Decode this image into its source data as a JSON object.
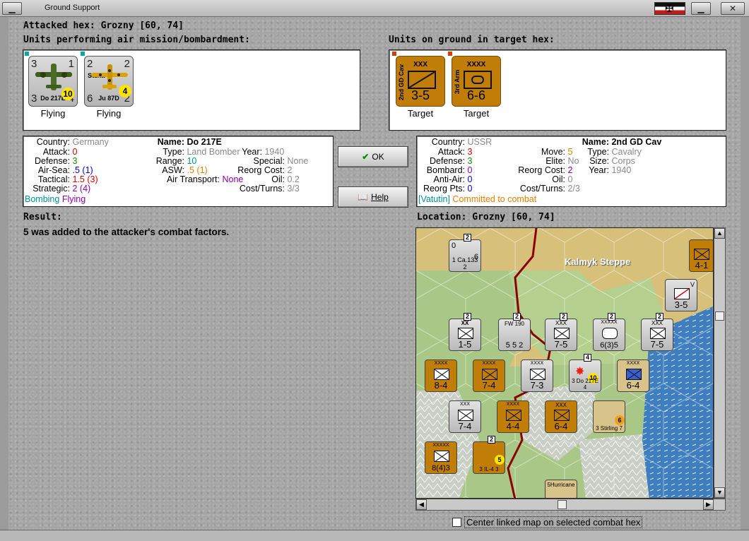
{
  "window": {
    "title": "Ground Support",
    "minimize_glyph": "▁",
    "close_glyph": "✕",
    "icon": "window-menu-icon",
    "flag": "german-war-flag-icon"
  },
  "attacked_hex": "Attacked hex: Grozny  [60, 74]",
  "air_section": {
    "heading": "Units performing air mission/bombardment:",
    "units": [
      {
        "name": "Do 217E",
        "top_left": "3",
        "top_right": "1",
        "bottom_left": "3",
        "bottom_right": "4",
        "badge": "10",
        "status": "Flying"
      },
      {
        "name": "Ju 87D",
        "sub": "Stuka",
        "top_left": "2",
        "top_right": "2",
        "bottom_left": "6",
        "bottom_right": "2",
        "badge": "4",
        "status": "Flying"
      }
    ]
  },
  "ground_section": {
    "heading": "Units on ground in target hex:",
    "units": [
      {
        "name": "2nd GD Cav",
        "echelon": "XXX",
        "values": "3-5",
        "status": "Target"
      },
      {
        "name": "3rd Arm",
        "echelon": "XXXX",
        "values": "6-6",
        "status": "Target"
      }
    ]
  },
  "attacker_info": {
    "country_label": "Country:",
    "country": "Germany",
    "attack_label": "Attack:",
    "attack": "0",
    "defense_label": "Defense:",
    "defense": "3",
    "airsea_label": "Air-Sea:",
    "airsea": ".5",
    "airsea_paren": "(1)",
    "tactical_label": "Tactical:",
    "tactical": "1.5",
    "tactical_paren": "(3)",
    "strategic_label": "Strategic:",
    "strategic": "2",
    "strategic_paren": "(4)",
    "mission": "Bombing",
    "mission_status": "Flying",
    "name_label": "Name:",
    "name": "Do 217E",
    "type_label": "Type:",
    "type": "Land Bomber",
    "year_label": "Year:",
    "year": "1940",
    "range_label": "Range:",
    "range": "10",
    "special_label": "Special:",
    "special": "None",
    "asw_label": "ASW:",
    "asw": ".5",
    "asw_paren": "(1)",
    "reorg_label": "Reorg Cost:",
    "reorg": "2",
    "airtransport_label": "Air Transport:",
    "airtransport": "None",
    "oil_label": "Oil:",
    "oil": "0.2",
    "cost_label": "Cost/Turns:",
    "cost": "3/3"
  },
  "buttons": {
    "ok": "OK",
    "help": "Help"
  },
  "defender_info": {
    "country_label": "Country:",
    "country": "USSR",
    "attack_label": "Attack:",
    "attack": "3",
    "defense_label": "Defense:",
    "defense": "3",
    "bombard_label": "Bombard:",
    "bombard": "0",
    "antiair_label": "Anti-Air:",
    "antiair": "0",
    "reorgpts_label": "Reorg Pts:",
    "reorgpts": "0",
    "commander": "[Vatutin]",
    "commit_status": "Committed to combat",
    "move_label": "Move:",
    "move": "5",
    "elite_label": "Elite:",
    "elite": "No",
    "reorg_label": "Reorg Cost:",
    "reorg": "2",
    "oil_label": "Oil:",
    "oil": "0",
    "cost_label": "Cost/Turns:",
    "cost": "2/3",
    "name_label": "Name:",
    "name": "2nd GD Cav",
    "type_label": "Type:",
    "type": "Cavalry",
    "size_label": "Size:",
    "size": "Corps",
    "year_label": "Year:",
    "year": "1940"
  },
  "result": {
    "heading": "Result:",
    "text": "5 was added to the attacker's combat factors."
  },
  "location": {
    "heading": "Location:  Grozny  [60, 74]",
    "region_label": "Kalmyk Steppe",
    "units": [
      {
        "id": "air-ca133",
        "kind": "g",
        "top": "0",
        "mid": "6",
        "bottom": "1 Ca.133 2",
        "stack": "2"
      },
      {
        "id": "corner-41",
        "kind": "b",
        "val": "4-1"
      },
      {
        "id": "vlasov",
        "kind": "g",
        "val": "3-5",
        "echelon": "V"
      },
      {
        "id": "u-15",
        "kind": "g",
        "val": "1-5",
        "echelon": "XX",
        "stack": "2"
      },
      {
        "id": "fw190",
        "kind": "g",
        "val": "5 5 2",
        "name": "FW 190",
        "stack": "2"
      },
      {
        "id": "u-75a",
        "kind": "g",
        "val": "7-5",
        "echelon": "XXX",
        "stack": "2"
      },
      {
        "id": "u-635",
        "kind": "g",
        "val": "6(3)5",
        "echelon": "XXXXX",
        "stack": "2"
      },
      {
        "id": "u-75b",
        "kind": "g",
        "val": "7-5",
        "echelon": "XXX",
        "stack": "2"
      },
      {
        "id": "u-84",
        "kind": "b",
        "val": "8-4",
        "echelon": "XXXX"
      },
      {
        "id": "u-74a",
        "kind": "b",
        "val": "7-4",
        "echelon": "XXXX"
      },
      {
        "id": "u-73",
        "kind": "g",
        "val": "7-3",
        "echelon": "XXXX"
      },
      {
        "id": "do217-map",
        "kind": "g",
        "val": "3 Do 217E 4",
        "badge": "10",
        "stack": "4"
      },
      {
        "id": "u-64a",
        "kind": "t",
        "val": "6-4",
        "echelon": "XXXX"
      },
      {
        "id": "u-74b",
        "kind": "g",
        "val": "7-4",
        "echelon": "XXX"
      },
      {
        "id": "u-44",
        "kind": "b",
        "val": "4-4",
        "echelon": "XXXX"
      },
      {
        "id": "u-64b",
        "kind": "b",
        "val": "6-4",
        "echelon": "XXX"
      },
      {
        "id": "stirling",
        "kind": "t",
        "val": "3 Stirling 7",
        "badge": "6"
      },
      {
        "id": "u-843",
        "kind": "b",
        "val": "8(4)3",
        "echelon": "XXXXX"
      },
      {
        "id": "il4",
        "kind": "b",
        "val": "3 IL-4 3",
        "badge": "5",
        "stack": "2"
      },
      {
        "id": "hurricane",
        "kind": "t",
        "val": "5Hurricane"
      }
    ]
  },
  "center_map_checkbox": "Center linked map on selected combat hex",
  "colors": {
    "unit_brown": "#c07d07",
    "neutral_gray": "#8a8a8a",
    "sea": "#3f7fbf",
    "steppe": "#d6c07a",
    "forest": "#9cbf78",
    "frontline": "#8b0000"
  }
}
